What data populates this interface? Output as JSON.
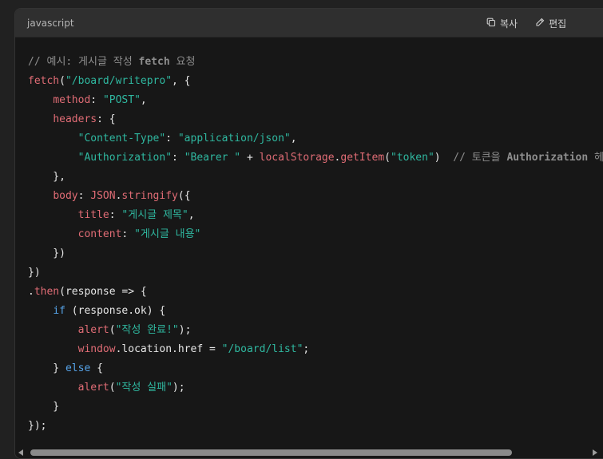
{
  "header": {
    "language": "javascript",
    "copy_label": "복사",
    "edit_label": "편집"
  },
  "code_lines": [
    [
      {
        "t": "comment",
        "v": "// 예시: 게시글 작성 "
      },
      {
        "t": "commentb",
        "v": "fetch"
      },
      {
        "t": "comment",
        "v": " 요청"
      }
    ],
    [
      {
        "t": "func",
        "v": "fetch"
      },
      {
        "t": "plain",
        "v": "("
      },
      {
        "t": "str",
        "v": "\"/board/writepro\""
      },
      {
        "t": "plain",
        "v": ", {"
      }
    ],
    [
      {
        "t": "plain",
        "v": "    "
      },
      {
        "t": "prop",
        "v": "method"
      },
      {
        "t": "plain",
        "v": ": "
      },
      {
        "t": "str",
        "v": "\"POST\""
      },
      {
        "t": "plain",
        "v": ","
      }
    ],
    [
      {
        "t": "plain",
        "v": "    "
      },
      {
        "t": "prop",
        "v": "headers"
      },
      {
        "t": "plain",
        "v": ": {"
      }
    ],
    [
      {
        "t": "plain",
        "v": "        "
      },
      {
        "t": "str",
        "v": "\"Content-Type\""
      },
      {
        "t": "plain",
        "v": ": "
      },
      {
        "t": "str",
        "v": "\"application/json\""
      },
      {
        "t": "plain",
        "v": ","
      }
    ],
    [
      {
        "t": "plain",
        "v": "        "
      },
      {
        "t": "str",
        "v": "\"Authorization\""
      },
      {
        "t": "plain",
        "v": ": "
      },
      {
        "t": "str",
        "v": "\"Bearer \""
      },
      {
        "t": "plain",
        "v": " + "
      },
      {
        "t": "func",
        "v": "localStorage"
      },
      {
        "t": "plain",
        "v": "."
      },
      {
        "t": "func",
        "v": "getItem"
      },
      {
        "t": "plain",
        "v": "("
      },
      {
        "t": "str",
        "v": "\"token\""
      },
      {
        "t": "plain",
        "v": ")  "
      },
      {
        "t": "comment",
        "v": "// 토큰을 "
      },
      {
        "t": "commentb",
        "v": "Authorization"
      },
      {
        "t": "comment",
        "v": " 헤"
      }
    ],
    [
      {
        "t": "plain",
        "v": "    },"
      }
    ],
    [
      {
        "t": "plain",
        "v": "    "
      },
      {
        "t": "prop",
        "v": "body"
      },
      {
        "t": "plain",
        "v": ": "
      },
      {
        "t": "func",
        "v": "JSON"
      },
      {
        "t": "plain",
        "v": "."
      },
      {
        "t": "func",
        "v": "stringify"
      },
      {
        "t": "plain",
        "v": "({"
      }
    ],
    [
      {
        "t": "plain",
        "v": "        "
      },
      {
        "t": "prop",
        "v": "title"
      },
      {
        "t": "plain",
        "v": ": "
      },
      {
        "t": "str",
        "v": "\"게시글 제목\""
      },
      {
        "t": "plain",
        "v": ","
      }
    ],
    [
      {
        "t": "plain",
        "v": "        "
      },
      {
        "t": "prop",
        "v": "content"
      },
      {
        "t": "plain",
        "v": ": "
      },
      {
        "t": "str",
        "v": "\"게시글 내용\""
      }
    ],
    [
      {
        "t": "plain",
        "v": "    })"
      }
    ],
    [
      {
        "t": "plain",
        "v": "})"
      }
    ],
    [
      {
        "t": "plain",
        "v": "."
      },
      {
        "t": "func",
        "v": "then"
      },
      {
        "t": "plain",
        "v": "(response => {"
      }
    ],
    [
      {
        "t": "plain",
        "v": "    "
      },
      {
        "t": "kw",
        "v": "if"
      },
      {
        "t": "plain",
        "v": " (response.ok) {"
      }
    ],
    [
      {
        "t": "plain",
        "v": "        "
      },
      {
        "t": "func",
        "v": "alert"
      },
      {
        "t": "plain",
        "v": "("
      },
      {
        "t": "str",
        "v": "\"작성 완료!\""
      },
      {
        "t": "plain",
        "v": ");"
      }
    ],
    [
      {
        "t": "plain",
        "v": "        "
      },
      {
        "t": "func",
        "v": "window"
      },
      {
        "t": "plain",
        "v": ".location.href = "
      },
      {
        "t": "str",
        "v": "\"/board/list\""
      },
      {
        "t": "plain",
        "v": ";"
      }
    ],
    [
      {
        "t": "plain",
        "v": "    } "
      },
      {
        "t": "kw",
        "v": "else"
      },
      {
        "t": "plain",
        "v": " {"
      }
    ],
    [
      {
        "t": "plain",
        "v": "        "
      },
      {
        "t": "func",
        "v": "alert"
      },
      {
        "t": "plain",
        "v": "("
      },
      {
        "t": "str",
        "v": "\"작성 실패\""
      },
      {
        "t": "plain",
        "v": ");"
      }
    ],
    [
      {
        "t": "plain",
        "v": "    }"
      }
    ],
    [
      {
        "t": "plain",
        "v": "});"
      }
    ]
  ],
  "colors": {
    "background": "#212121",
    "code_background": "#171717",
    "header_background": "#2f2f2f",
    "string": "#2fb8a0",
    "function": "#e06c75",
    "keyword": "#56a3e8",
    "comment": "#8e8e8e"
  },
  "icons": {
    "copy": "copy-icon",
    "edit": "pencil-icon"
  }
}
